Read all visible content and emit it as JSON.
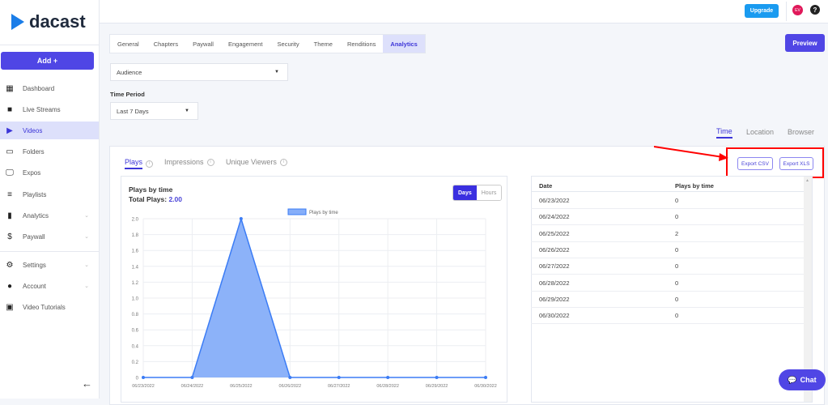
{
  "brand": {
    "name": "dacast"
  },
  "sidebar": {
    "add_label": "Add +",
    "items": [
      {
        "label": "Dashboard",
        "icon": "dashboard-icon"
      },
      {
        "label": "Live Streams",
        "icon": "camera-icon"
      },
      {
        "label": "Videos",
        "icon": "play-icon",
        "active": true
      },
      {
        "label": "Folders",
        "icon": "folder-icon"
      },
      {
        "label": "Expos",
        "icon": "monitor-icon"
      },
      {
        "label": "Playlists",
        "icon": "playlist-icon"
      },
      {
        "label": "Analytics",
        "icon": "bar-chart-icon",
        "expandable": true
      },
      {
        "label": "Paywall",
        "icon": "dollar-icon",
        "expandable": true
      },
      {
        "label": "Settings",
        "icon": "gear-icon",
        "expandable": true
      },
      {
        "label": "Account",
        "icon": "person-icon",
        "expandable": true
      },
      {
        "label": "Video Tutorials",
        "icon": "video-library-icon"
      }
    ]
  },
  "topbar": {
    "upgrade_label": "Upgrade",
    "avatar_initials": "EV",
    "help": "?"
  },
  "tabs": [
    {
      "label": "General"
    },
    {
      "label": "Chapters"
    },
    {
      "label": "Paywall"
    },
    {
      "label": "Engagement"
    },
    {
      "label": "Security"
    },
    {
      "label": "Theme"
    },
    {
      "label": "Renditions"
    },
    {
      "label": "Analytics",
      "active": true
    }
  ],
  "preview_label": "Preview",
  "report_select": {
    "value": "Audience"
  },
  "time_period": {
    "label": "Time Period",
    "value": "Last 7 Days"
  },
  "view_tabs": [
    {
      "label": "Time",
      "active": true
    },
    {
      "label": "Location"
    },
    {
      "label": "Browser"
    }
  ],
  "metric_tabs": [
    {
      "label": "Plays",
      "active": true
    },
    {
      "label": "Impressions"
    },
    {
      "label": "Unique Viewers"
    }
  ],
  "export": {
    "csv": "Export CSV",
    "xls": "Export XLS"
  },
  "chart_panel": {
    "title": "Plays by time",
    "total_label": "Total Plays:",
    "total_value": "2.00",
    "toggle": {
      "days": "Days",
      "hours": "Hours"
    }
  },
  "chat_label": "Chat",
  "colors": {
    "accent": "#4f46e5",
    "area_fill": "#86aef9",
    "line": "#3b7cf5",
    "highlight": "#ff0000"
  },
  "chart_data": {
    "type": "area",
    "legend": "Plays by time",
    "legend_position": "top",
    "categories": [
      "06/23/2022",
      "06/24/2022",
      "06/25/2022",
      "06/26/2022",
      "06/27/2022",
      "06/28/2022",
      "06/29/2022",
      "06/30/2022"
    ],
    "series": [
      {
        "name": "Plays by time",
        "values": [
          0,
          0,
          2,
          0,
          0,
          0,
          0,
          0
        ]
      }
    ],
    "ylim": [
      0,
      2.0
    ],
    "yticks": [
      "0",
      "0.2",
      "0.4",
      "0.6",
      "0.8",
      "1.0",
      "1.2",
      "1.4",
      "1.6",
      "1.8",
      "2.0"
    ],
    "grid": true
  },
  "table": {
    "headers": [
      "Date",
      "Plays by time"
    ],
    "rows": [
      [
        "06/23/2022",
        "0"
      ],
      [
        "06/24/2022",
        "0"
      ],
      [
        "06/25/2022",
        "2"
      ],
      [
        "06/26/2022",
        "0"
      ],
      [
        "06/27/2022",
        "0"
      ],
      [
        "06/28/2022",
        "0"
      ],
      [
        "06/29/2022",
        "0"
      ],
      [
        "06/30/2022",
        "0"
      ]
    ]
  }
}
